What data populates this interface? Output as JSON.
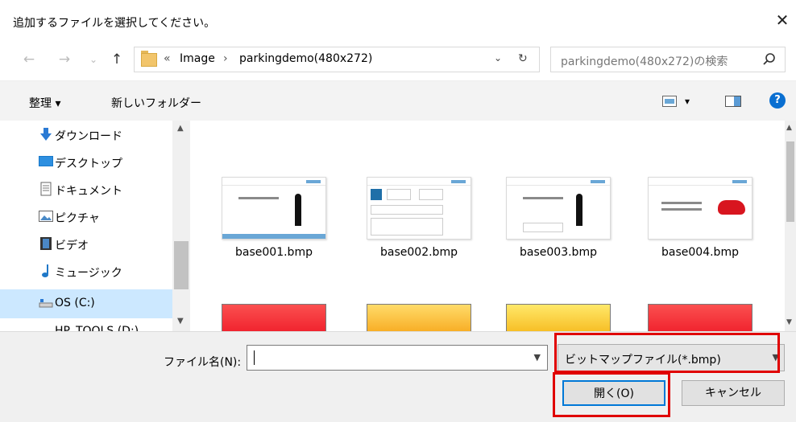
{
  "window": {
    "title": "追加するファイルを選択してください。",
    "close": "✕"
  },
  "nav": {
    "back": "←",
    "forward": "→",
    "recent": "⌄",
    "up": "↑"
  },
  "address": {
    "overflow": "«",
    "crumbs": [
      "Image",
      "parkingdemo(480x272)"
    ],
    "sep": "›",
    "dropdown": "⌄",
    "refresh": "↻"
  },
  "search": {
    "placeholder": "parkingdemo(480x272)の検索"
  },
  "toolbar": {
    "organize": "整理 ▾",
    "new_folder": "新しいフォルダー",
    "view_dd": "▾",
    "help": "?"
  },
  "sidebar": {
    "items": [
      {
        "label": "ダウンロード",
        "icon": "download-icon"
      },
      {
        "label": "デスクトップ",
        "icon": "desktop-icon"
      },
      {
        "label": "ドキュメント",
        "icon": "document-icon"
      },
      {
        "label": "ピクチャ",
        "icon": "pictures-icon"
      },
      {
        "label": "ビデオ",
        "icon": "video-icon"
      },
      {
        "label": "ミュージック",
        "icon": "music-icon"
      },
      {
        "label": "OS (C:)",
        "icon": "drive-icon"
      },
      {
        "label": "HP_TOOLS (D:)",
        "icon": "drive-icon"
      }
    ]
  },
  "files": [
    {
      "name": "base001.bmp"
    },
    {
      "name": "base002.bmp"
    },
    {
      "name": "base003.bmp"
    },
    {
      "name": "base004.bmp"
    }
  ],
  "footer": {
    "filename_label": "ファイル名(N):",
    "filename_value": "",
    "filter": "ビットマップファイル(*.bmp)",
    "open": "開く(O)",
    "cancel": "キャンセル"
  },
  "colors": {
    "highlight": "#e00000",
    "accent": "#0078d7",
    "selected": "#cce8ff"
  }
}
